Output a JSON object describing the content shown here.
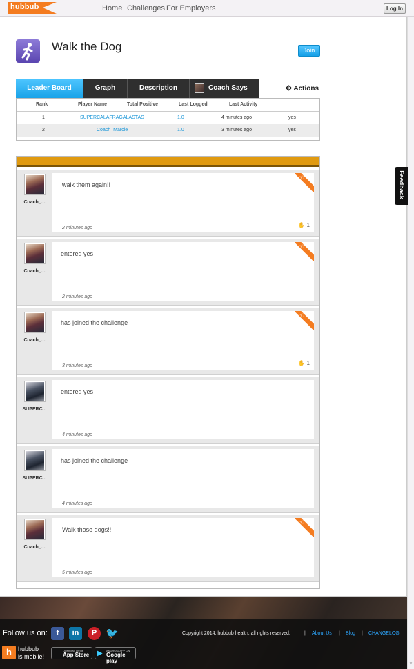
{
  "nav": {
    "logo": "hubbub",
    "links": [
      "Home",
      "Challenges",
      "For Employers"
    ],
    "login": "Log In"
  },
  "challenge": {
    "title": "Walk the Dog",
    "join": "Join"
  },
  "tabs": [
    "Leader Board",
    "Graph",
    "Description",
    "Coach Says"
  ],
  "actions": "Actions",
  "leaderboard": {
    "headers": [
      "Rank",
      "Player Name",
      "Total Positive",
      "Last Logged",
      "Last Activity"
    ],
    "rows": [
      {
        "rank": "1",
        "player": "SUPERCALAFRAGALASTAS",
        "total": "1.0",
        "logged": "4 minutes ago",
        "activity": "yes"
      },
      {
        "rank": "2",
        "player": "Coach_Marcie",
        "total": "1.0",
        "logged": "3 minutes ago",
        "activity": "yes"
      }
    ]
  },
  "feed": [
    {
      "user": "Coach_...",
      "message": "walk them again!!",
      "time": "2 minutes ago",
      "coach": true,
      "highfive": "1"
    },
    {
      "user": "Coach_...",
      "message": "entered yes",
      "time": "2 minutes ago",
      "coach": true,
      "highfive": ""
    },
    {
      "user": "Coach_...",
      "message": "has joined the challenge",
      "time": "3 minutes ago",
      "coach": true,
      "highfive": "1"
    },
    {
      "user": "SUPERC...",
      "message": "entered yes",
      "time": "4 minutes ago",
      "coach": false,
      "highfive": ""
    },
    {
      "user": "SUPERC...",
      "message": "has joined the challenge",
      "time": "4 minutes ago",
      "coach": false,
      "highfive": ""
    },
    {
      "user": "Coach_...",
      "message": "Walk those dogs!!",
      "time": "5 minutes ago",
      "coach": true,
      "highfive": ""
    }
  ],
  "feedback": "Feedback",
  "footer": {
    "follow": "Follow us on:",
    "copyright": "Copyright 2014, hubbub health, all rights reserved.",
    "links": [
      "About Us",
      "Blog",
      "CHANGELOG"
    ],
    "mobile_logo": "h",
    "mobile_line1": "hubbub",
    "mobile_line2": "is mobile!",
    "appstore_small": "Download on the",
    "appstore": "App Store",
    "googleplay_small": "ANDROID APP ON",
    "googleplay": "Google play"
  },
  "colors": {
    "accent": "#1aa3e8",
    "orange": "#f47c20",
    "feed_header": "#e09a10"
  }
}
